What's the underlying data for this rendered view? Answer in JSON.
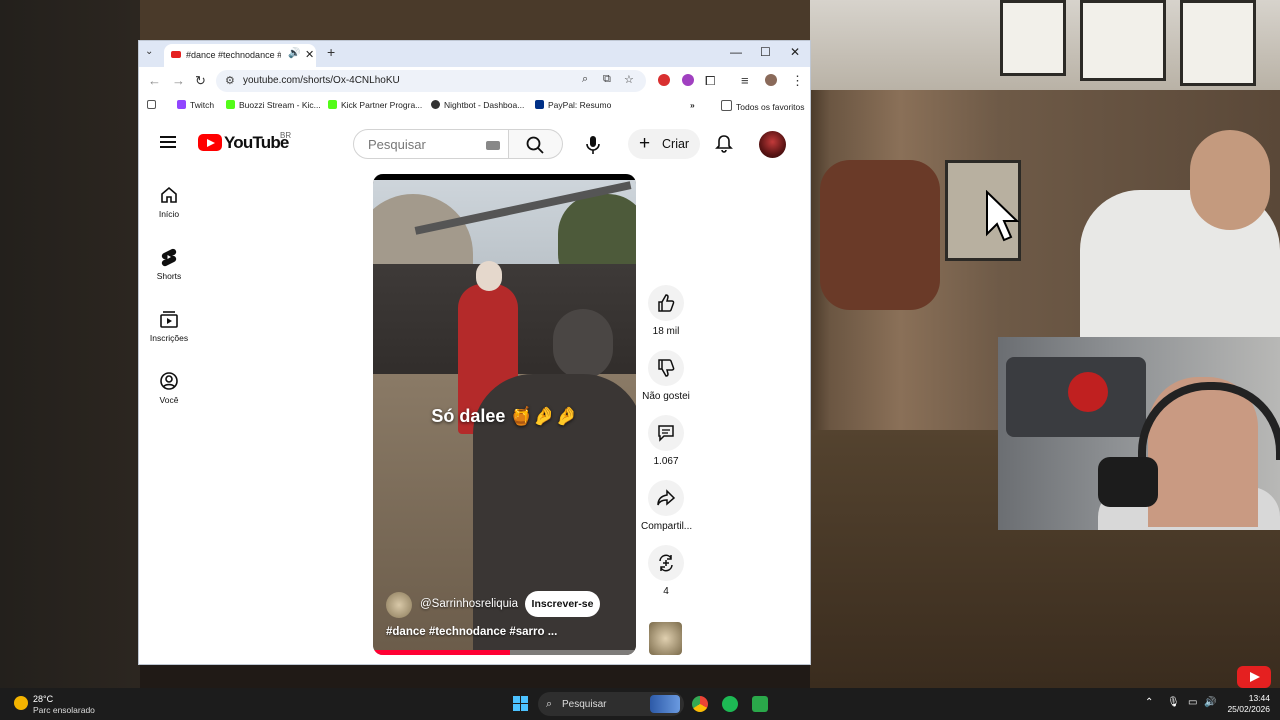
{
  "browser": {
    "tab_title": "#dance #technodance #sarro",
    "url": "youtube.com/shorts/Ox-4CNLhoKU",
    "bookmarks": [
      "Twitch",
      "Buozzi Stream - Kic...",
      "Kick Partner Progra...",
      "Nightbot - Dashboa...",
      "PayPal: Resumo"
    ],
    "all_bookmarks": "Todos os favoritos"
  },
  "youtube": {
    "logo_text": "YouTube",
    "region": "BR",
    "search_placeholder": "Pesquisar",
    "create_label": "Criar",
    "sidebar": [
      {
        "label": "Início",
        "icon": "home-icon"
      },
      {
        "label": "Shorts",
        "icon": "shorts-icon"
      },
      {
        "label": "Inscrições",
        "icon": "subscriptions-icon"
      },
      {
        "label": "Você",
        "icon": "you-icon"
      }
    ],
    "video": {
      "caption": "Só dalee 🍯🤌🤌",
      "channel": "@Sarrinhosreliquia",
      "subscribe_label": "Inscrever-se",
      "hashtags": "#dance #technodance #sarro ...",
      "progress": 0.52
    },
    "actions": {
      "like_count": "18 mil",
      "dislike_label": "Não gostei",
      "comment_count": "1.067",
      "share_label": "Compartil...",
      "remix_count": "4"
    }
  },
  "taskbar": {
    "temperature": "28°C",
    "weather_desc": "Parc ensolarado",
    "search_label": "Pesquisar",
    "time": "13:44",
    "date": "25/02/2026"
  },
  "colors": {
    "youtube_red": "#ff0000",
    "progress_red": "#ff0033",
    "tabbar": "#dfe7f5",
    "taskbar": "#1c1c1c"
  }
}
